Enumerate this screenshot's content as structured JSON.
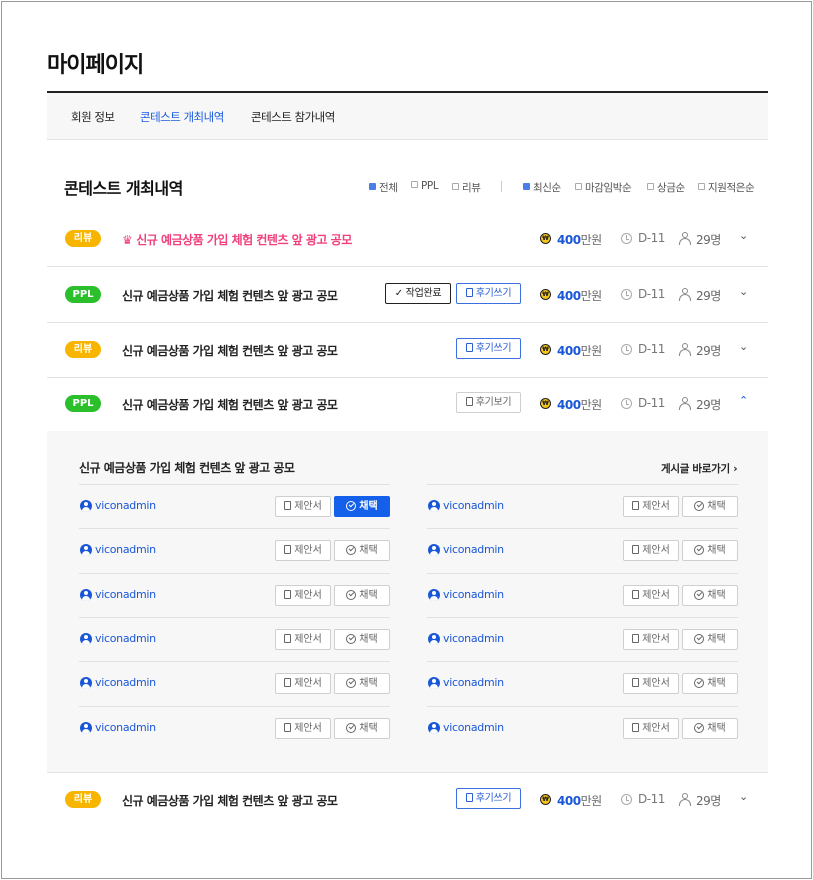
{
  "page": {
    "title": "마이페이지"
  },
  "tabs": [
    {
      "label": "회원 정보"
    },
    {
      "label": "콘테스트 개최내역"
    },
    {
      "label": "콘테스트 참가내역"
    }
  ],
  "section": {
    "title": "콘테스트 개최내역",
    "type_filters": [
      {
        "label": "전체",
        "checked": true
      },
      {
        "label": "PPL",
        "checked": false
      },
      {
        "label": "리뷰",
        "checked": false
      }
    ],
    "sort_filters": [
      {
        "label": "최신순",
        "checked": true
      },
      {
        "label": "마감임박순",
        "checked": false
      },
      {
        "label": "상금순",
        "checked": false
      },
      {
        "label": "지원적은순",
        "checked": false
      }
    ]
  },
  "icons": {
    "crown": "crown-icon",
    "coin": "won-coin-icon",
    "clock": "clock-icon",
    "person": "person-icon",
    "chevron": "chevron-icon",
    "doc": "document-icon",
    "check": "check-circle-icon",
    "avatar": "user-avatar-icon"
  },
  "colors": {
    "accent": "#1a57d8",
    "review_badge": "#f7b500",
    "ppl_badge": "#2bbf2b",
    "hot_title": "#f0407a",
    "selected_button": "#1560ea"
  },
  "contests": [
    {
      "badge": "리뷰",
      "title": "신규 예금상품 가입 체험 컨텐츠 앞 광고 공모",
      "featured": true,
      "prize_num": "400",
      "prize_unit": "만원",
      "dday": "D-11",
      "applicants": "29명",
      "chevron": "⌄"
    },
    {
      "badge": "PPL",
      "title": "신규 예금상품 가입 체험 컨텐츠 앞 광고 공모",
      "done_label": "작업완료",
      "review_label": "후기쓰기",
      "prize_num": "400",
      "prize_unit": "만원",
      "dday": "D-11",
      "applicants": "29명",
      "chevron": "⌄"
    },
    {
      "badge": "리뷰",
      "title": "신규 예금상품 가입 체험 컨텐츠 앞 광고 공모",
      "review_label": "후기쓰기",
      "prize_num": "400",
      "prize_unit": "만원",
      "dday": "D-11",
      "applicants": "29명",
      "chevron": "⌄"
    },
    {
      "badge": "PPL",
      "title": "신규 예금상품 가입 체험 컨텐츠 앞 광고 공모",
      "view_label": "후기보기",
      "prize_num": "400",
      "prize_unit": "만원",
      "dday": "D-11",
      "applicants": "29명",
      "chevron": "⌃",
      "expanded": true
    },
    {
      "badge": "리뷰",
      "title": "신규 예금상품 가입 체험 컨텐츠 앞 광고 공모",
      "review_label": "후기쓰기",
      "prize_num": "400",
      "prize_unit": "만원",
      "dday": "D-11",
      "applicants": "29명",
      "chevron": "⌄"
    }
  ],
  "detail": {
    "title": "신규 예금상품 가입 체험 컨텐츠 앞 광고 공모",
    "goto_label": "게시글 바로가기 ›",
    "proposal_label": "제안서",
    "adopt_label": "채택",
    "proposals": [
      {
        "user": "viconadmin",
        "adopted": true
      },
      {
        "user": "viconadmin",
        "adopted": false
      },
      {
        "user": "viconadmin",
        "adopted": false
      },
      {
        "user": "viconadmin",
        "adopted": false
      },
      {
        "user": "viconadmin",
        "adopted": false
      },
      {
        "user": "viconadmin",
        "adopted": false
      },
      {
        "user": "viconadmin",
        "adopted": false
      },
      {
        "user": "viconadmin",
        "adopted": false
      },
      {
        "user": "viconadmin",
        "adopted": false
      },
      {
        "user": "viconadmin",
        "adopted": false
      },
      {
        "user": "viconadmin",
        "adopted": false
      },
      {
        "user": "viconadmin",
        "adopted": false
      }
    ]
  }
}
